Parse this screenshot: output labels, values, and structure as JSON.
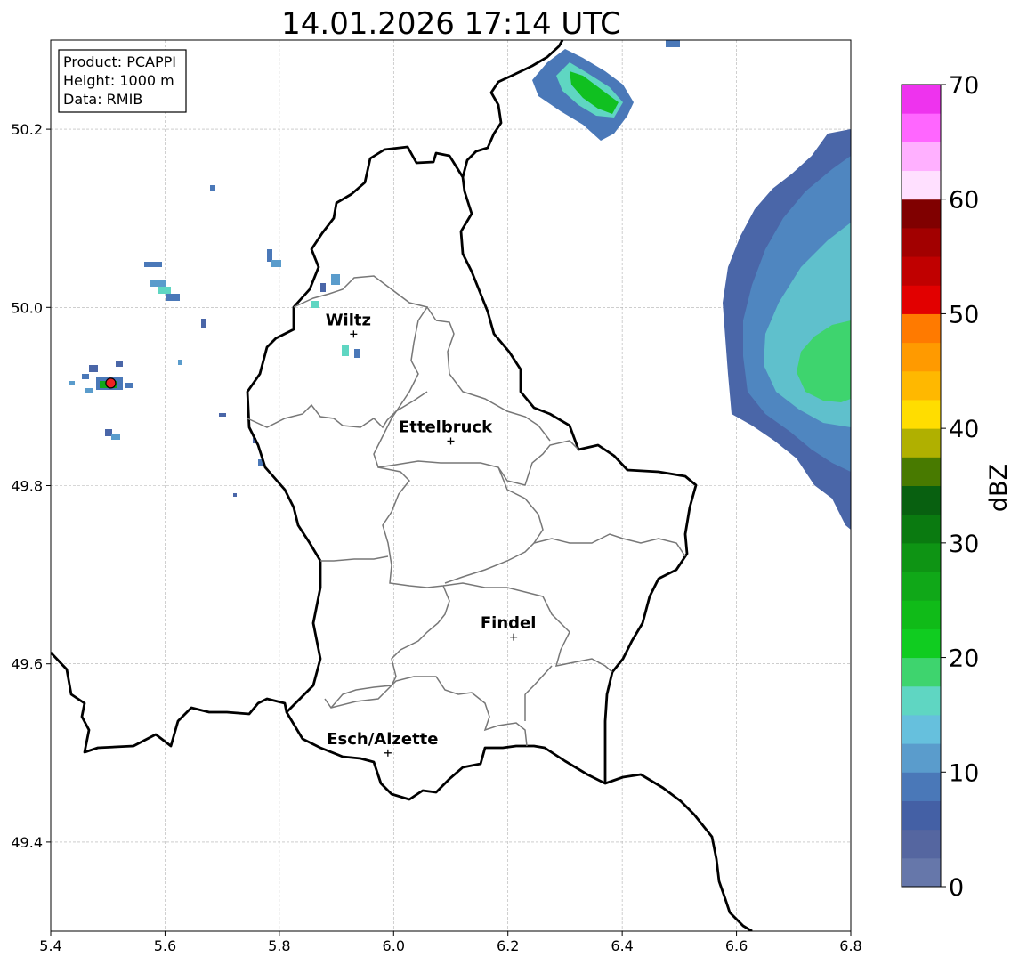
{
  "title": "14.01.2026 17:14 UTC",
  "info_box": {
    "lines": [
      "Product: PCAPPI",
      "Height: 1000 m",
      "Data: RMIB"
    ]
  },
  "axes": {
    "x_ticks": [
      "5.4",
      "5.6",
      "5.8",
      "6.0",
      "6.2",
      "6.4",
      "6.6",
      "6.8"
    ],
    "y_ticks": [
      "50.2",
      "50.0",
      "49.8",
      "49.6",
      "49.4"
    ],
    "xlim": [
      5.4,
      6.8
    ],
    "ylim": [
      49.3,
      50.3
    ],
    "grid": true
  },
  "colorbar": {
    "label": "dBZ",
    "ticks": [
      "0",
      "10",
      "20",
      "30",
      "40",
      "50",
      "60",
      "70"
    ],
    "range": [
      0,
      70
    ],
    "colors": [
      "#6677aa",
      "#5566a0",
      "#4460a5",
      "#4a78b8",
      "#5a9ccc",
      "#66c0dd",
      "#5fd6c2",
      "#3ed46e",
      "#10cc20",
      "#10bb18",
      "#10a818",
      "#0e9414",
      "#0a7a10",
      "#086010",
      "#487a00",
      "#b0b000",
      "#ffdd00",
      "#ffb800",
      "#ff9a00",
      "#ff7a00",
      "#e20000",
      "#c00000",
      "#a20000",
      "#800000",
      "#ffe0ff",
      "#ffb0ff",
      "#ff66ff",
      "#ee33ee"
    ]
  },
  "cities": [
    {
      "name": "Wiltz",
      "lon": 5.93,
      "lat": 49.97
    },
    {
      "name": "Ettelbruck",
      "lon": 6.1,
      "lat": 49.85
    },
    {
      "name": "Findel",
      "lon": 6.21,
      "lat": 49.63
    },
    {
      "name": "Esch/Alzette",
      "lon": 5.99,
      "lat": 49.5
    }
  ],
  "radar_site": {
    "lon": 5.505,
    "lat": 49.915,
    "color": "#ee2222"
  },
  "border_color": "#000000",
  "canton_color": "#777777"
}
